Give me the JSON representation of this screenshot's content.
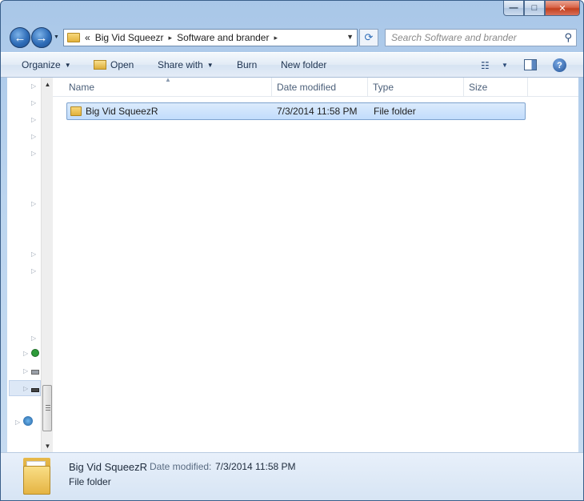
{
  "window": {
    "controls": {
      "minimize": "—",
      "maximize": "□",
      "close": "✕"
    }
  },
  "nav": {
    "back_glyph": "←",
    "forward_glyph": "→",
    "breadcrumb": {
      "overflow": "«",
      "items": [
        "Big Vid Squeezr",
        "Software and brander"
      ],
      "separator": "▸"
    },
    "search_placeholder": "Search Software and brander"
  },
  "toolbar": {
    "organize": "Organize",
    "open": "Open",
    "share_with": "Share with",
    "burn": "Burn",
    "new_folder": "New folder"
  },
  "columns": {
    "name": "Name",
    "date_modified": "Date modified",
    "type": "Type",
    "size": "Size"
  },
  "files": [
    {
      "name": "Big Vid SqueezR",
      "date_modified": "7/3/2014 11:58 PM",
      "type": "File folder",
      "size": "",
      "icon": "folder-icon",
      "selected": true
    }
  ],
  "details": {
    "name": "Big Vid SqueezR",
    "date_label": "Date modified:",
    "date_value": "7/3/2014 11:58 PM",
    "type": "File folder"
  },
  "colors": {
    "selection": "#c1dcfc",
    "selection_border": "#7da2ce",
    "accent": "#2f6db8"
  }
}
